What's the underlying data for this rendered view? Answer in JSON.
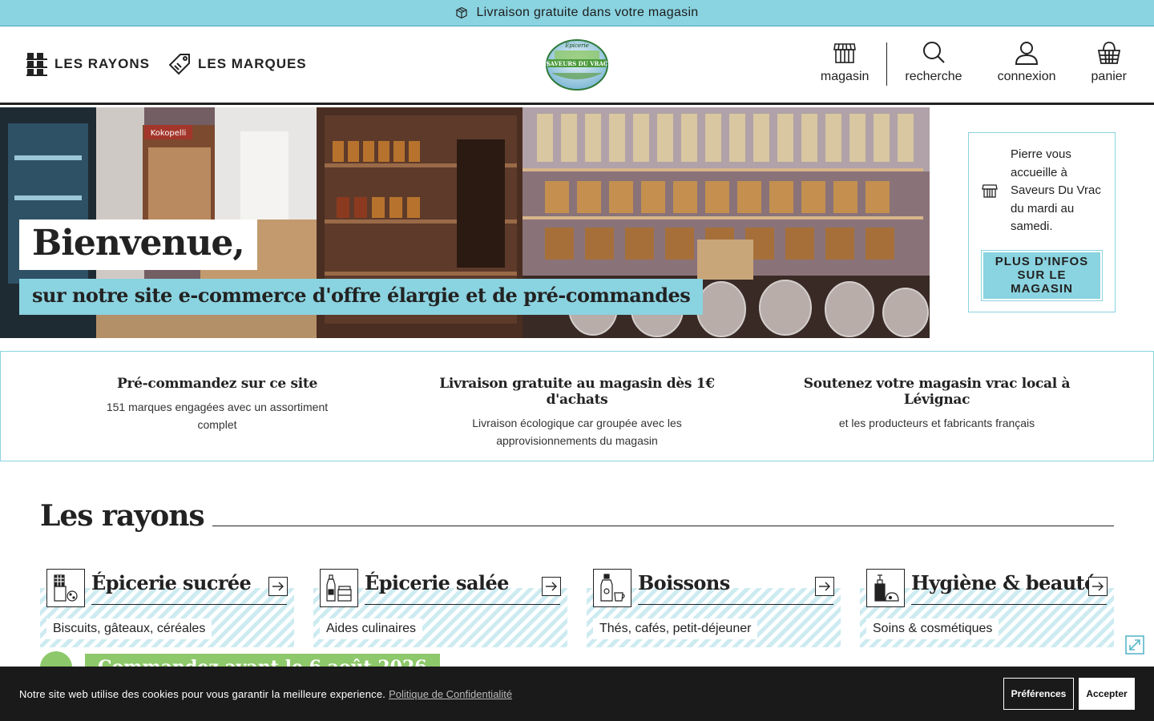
{
  "promo": {
    "text": "Livraison gratuite dans votre magasin",
    "icon": "box-icon"
  },
  "header": {
    "nav_left": [
      {
        "label": "LES RAYONS",
        "icon": "shelves-icon"
      },
      {
        "label": "LES MARQUES",
        "icon": "tag-icon"
      }
    ],
    "logo": {
      "top_text": "Epicerie",
      "main_text": "SAVEURS DU VRAC"
    },
    "nav_right": [
      {
        "label": "magasin",
        "icon": "store-icon"
      },
      {
        "label": "recherche",
        "icon": "search-icon"
      },
      {
        "label": "connexion",
        "icon": "user-icon"
      },
      {
        "label": "panier",
        "icon": "basket-icon"
      }
    ]
  },
  "hero": {
    "title": "Bienvenue,",
    "subtitle": "sur notre site e-commerce d'offre élargie et de pré-commandes",
    "photo_sign": "Kokopelli"
  },
  "store_card": {
    "text": "Pierre vous accueille à Saveurs Du Vrac du mardi au samedi.",
    "button": "PLUS D'INFOS SUR LE MAGASIN"
  },
  "features": [
    {
      "title": "Pré-commandez sur ce site",
      "text": "151 marques engagées avec un assortiment complet"
    },
    {
      "title": "Livraison gratuite au magasin dès 1€ d'achats",
      "text": "Livraison écologique car groupée avec les approvisionnements du magasin"
    },
    {
      "title": "Soutenez votre magasin vrac local à Lévignac",
      "text": "et les producteurs et fabricants français"
    }
  ],
  "rayons": {
    "title": "Les rayons",
    "items": [
      {
        "name": "Épicerie sucrée",
        "sub": "Biscuits, gâteaux, céréales",
        "icon": "sweet-grocery-icon"
      },
      {
        "name": "Épicerie salée",
        "sub": "Aides culinaires",
        "icon": "savory-grocery-icon"
      },
      {
        "name": "Boissons",
        "sub": "Thés, cafés, petit-déjeuner",
        "icon": "drinks-icon"
      },
      {
        "name": "Hygiène & beauté",
        "sub": "Soins & cosmétiques",
        "icon": "hygiene-icon"
      }
    ]
  },
  "preorder": {
    "text": "Commandez avant le 6 août 2026"
  },
  "cookie": {
    "text": "Notre site web utilise des cookies pour vous garantir la meilleure experience.",
    "link": "Politique de Confidentialité",
    "preferences": "Préférences",
    "accept": "Accepter"
  },
  "colors": {
    "accent": "#8ad3e0",
    "dark": "#1a1a1a",
    "green": "#8dc86a"
  }
}
